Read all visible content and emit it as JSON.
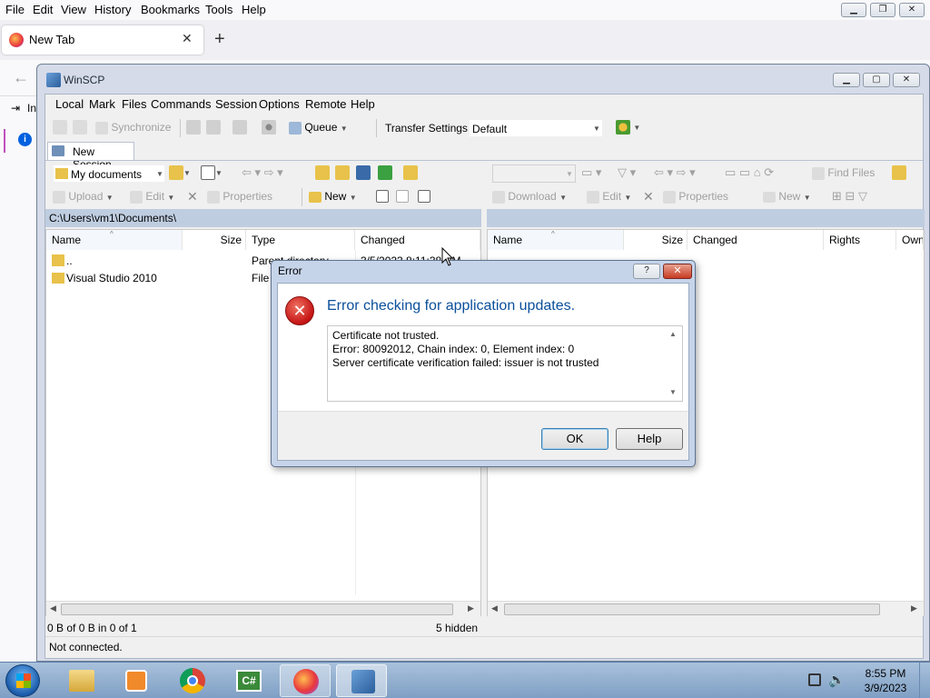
{
  "firefox": {
    "menu": [
      "File",
      "Edit",
      "View",
      "History",
      "Bookmarks",
      "Tools",
      "Help"
    ],
    "tab_title": "New Tab",
    "side_text": "In"
  },
  "winscp": {
    "title": "WinSCP",
    "menu": [
      "Local",
      "Mark",
      "Files",
      "Commands",
      "Session",
      "Options",
      "Remote",
      "Help"
    ],
    "toolbar": {
      "synchronize": "Synchronize",
      "queue": "Queue",
      "transfer_settings": "Transfer Settings",
      "transfer_value": "Default"
    },
    "new_session_tab": "New Session",
    "left_panel": {
      "location": "My documents",
      "upload": "Upload",
      "edit": "Edit",
      "properties": "Properties",
      "new": "New",
      "path": "C:\\Users\\vm1\\Documents\\",
      "columns": [
        "Name",
        "Size",
        "Type",
        "Changed"
      ],
      "rows": [
        {
          "name": "..",
          "type": "Parent directory",
          "changed": "3/5/2023 8:11:38 PM"
        },
        {
          "name": "Visual Studio 2010",
          "type": "File folder",
          "changed": ""
        }
      ],
      "status_left": "0 B of 0 B in 0 of 1",
      "status_right": "5 hidden"
    },
    "right_panel": {
      "find_files": "Find Files",
      "download": "Download",
      "edit": "Edit",
      "properties": "Properties",
      "new": "New",
      "columns": [
        "Name",
        "Size",
        "Changed",
        "Rights",
        "Owner"
      ]
    },
    "status_bar": "Not connected."
  },
  "dialog": {
    "title": "Error",
    "help_btn": "?",
    "message": "Error checking for application updates.",
    "details": [
      "Certificate not trusted.",
      "Error: 80092012, Chain index: 0, Element index: 0",
      "Server certificate verification failed: issuer is not trusted"
    ],
    "ok": "OK",
    "help": "Help"
  },
  "taskbar": {
    "time": "8:55 PM",
    "date": "3/9/2023",
    "apps": [
      "file-explorer",
      "media-player",
      "chrome",
      "csharp-ide",
      "firefox",
      "winscp"
    ]
  },
  "colors": {
    "accent": "#0b4f9c",
    "error_red": "#d21f1f",
    "path_bar": "#bfcde0"
  }
}
